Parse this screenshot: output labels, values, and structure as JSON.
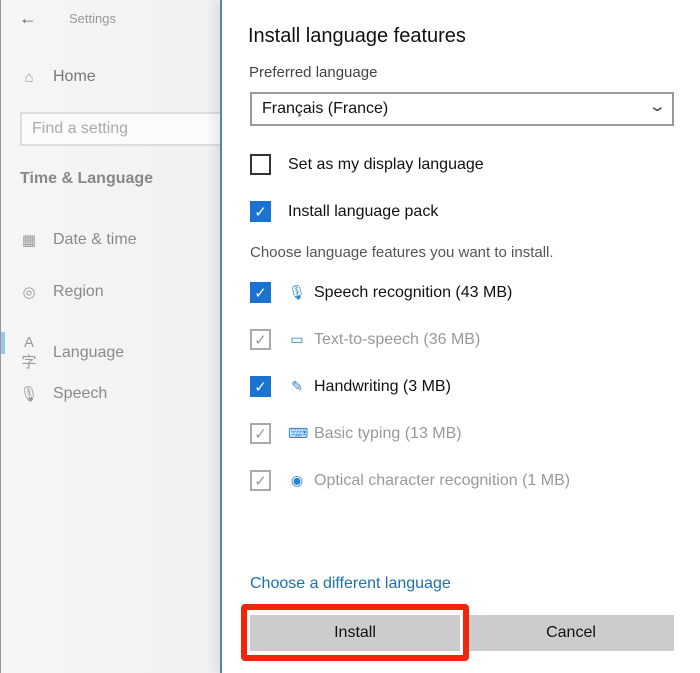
{
  "sidebar": {
    "app_title": "Settings",
    "home": "Home",
    "search_placeholder": "Find a setting",
    "section": "Time & Language",
    "items": [
      {
        "label": "Date & time",
        "icon": "calendar-clock-icon"
      },
      {
        "label": "Region",
        "icon": "globe-icon"
      },
      {
        "label": "Language",
        "icon": "language-icon"
      },
      {
        "label": "Speech",
        "icon": "microphone-icon"
      }
    ],
    "selected": "Language"
  },
  "dialog": {
    "title": "Install language features",
    "preferred_label": "Preferred language",
    "preferred_value": "Français (France)",
    "options": [
      {
        "label": "Set as my display language",
        "checked": false
      },
      {
        "label": "Install language pack",
        "checked": true
      }
    ],
    "features_caption": "Choose language features you want to install.",
    "features": [
      {
        "label": "Speech recognition (43 MB)",
        "checked": true,
        "enabled": true,
        "icon": "microphone-icon"
      },
      {
        "label": "Text-to-speech (36 MB)",
        "checked": true,
        "enabled": false,
        "icon": "speech-bubble-monitor-icon"
      },
      {
        "label": "Handwriting (3 MB)",
        "checked": true,
        "enabled": true,
        "icon": "pen-icon"
      },
      {
        "label": "Basic typing (13 MB)",
        "checked": true,
        "enabled": false,
        "icon": "keyboard-icon"
      },
      {
        "label": "Optical character recognition (1 MB)",
        "checked": true,
        "enabled": false,
        "icon": "webcam-icon"
      }
    ],
    "link": "Choose a different language",
    "install": "Install",
    "cancel": "Cancel",
    "accent": "#1a73d1",
    "highlight": "#f2240a"
  }
}
